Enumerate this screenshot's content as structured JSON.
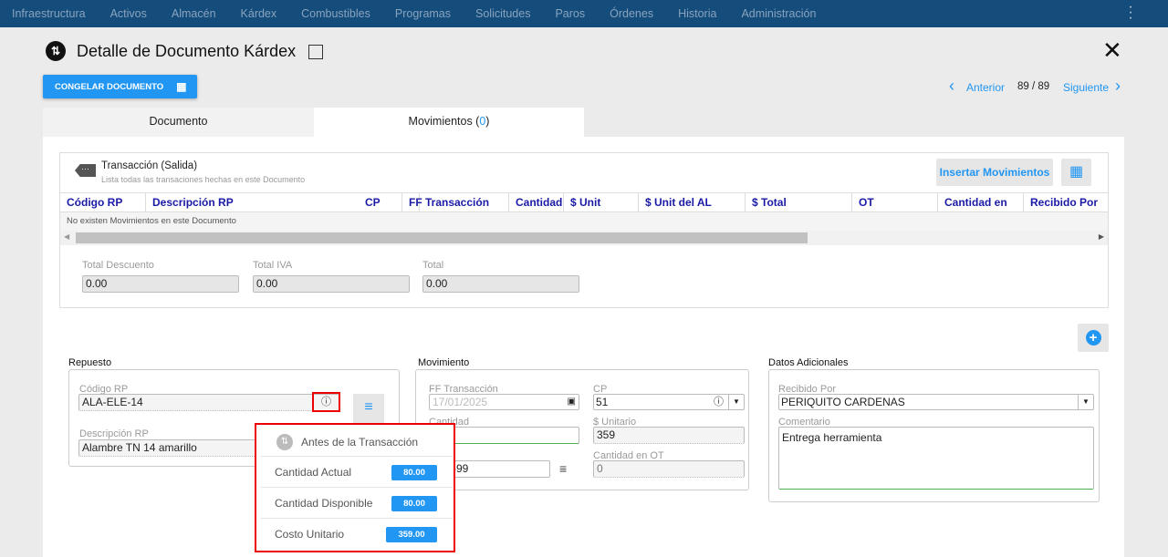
{
  "nav": {
    "items": [
      "Infraestructura",
      "Activos",
      "Almacén",
      "Kárdex",
      "Combustibles",
      "Programas",
      "Solicitudes",
      "Paros",
      "Órdenes",
      "Historia",
      "Administración"
    ]
  },
  "header": {
    "title": "Detalle de Documento Kárdex",
    "freeze_button": "CONGELAR DOCUMENTO",
    "prev": "Anterior",
    "page": "89 / 89",
    "next": "Siguiente"
  },
  "tabs": {
    "documento": "Documento",
    "movimientos": "Movimientos (",
    "count": "0",
    "close_paren": ")"
  },
  "card": {
    "title": "Transacción (Salida)",
    "subtitle": "Lista todas las transaciones hechas en este Documento",
    "insert_button": "Insertar Movimientos",
    "columns": [
      "Código RP",
      "Descripción RP",
      "CP",
      "FF Transacción",
      "Cantidad",
      "$ Unit",
      "$ Unit del AL",
      "$ Total",
      "OT",
      "Cantidad en OT",
      "Recibido Por"
    ],
    "empty": "No existen Movimientos en este Documento",
    "totals": [
      {
        "label": "Total Descuento",
        "value": "0.00"
      },
      {
        "label": "Total IVA",
        "value": "0.00"
      },
      {
        "label": "Total",
        "value": "0.00"
      }
    ]
  },
  "repuesto": {
    "title": "Repuesto",
    "codigo_label": "Código RP",
    "codigo": "ALA-ELE-14",
    "desc_label": "Descripción RP",
    "desc": "Alambre TN 14 amarillo"
  },
  "movimiento": {
    "title": "Movimiento",
    "ff_label": "FF Transacción",
    "ff": "17/01/2025",
    "cp_label": "CP",
    "cp": "51",
    "cantidad_label": "Cantidad",
    "unit_label": "$ Unitario",
    "unit": "359",
    "ot": "-99",
    "cant_ot_label": "Cantidad en OT",
    "cant_ot": "0"
  },
  "adicionales": {
    "title": "Datos Adicionales",
    "recibido_label": "Recibido Por",
    "recibido": "PERIQUITO CARDENAS",
    "comentario_label": "Comentario",
    "comentario": "Entrega herramienta"
  },
  "popup": {
    "title": "Antes de la Transacción",
    "rows": [
      {
        "label": "Cantidad Actual",
        "value": "80.00"
      },
      {
        "label": "Cantidad Disponible",
        "value": "80.00"
      },
      {
        "label": "Costo Unitario",
        "value": "359.00"
      }
    ]
  },
  "colors": {
    "nav": "#144c7c",
    "accent": "#2196f3",
    "highlight": "#e00000"
  }
}
